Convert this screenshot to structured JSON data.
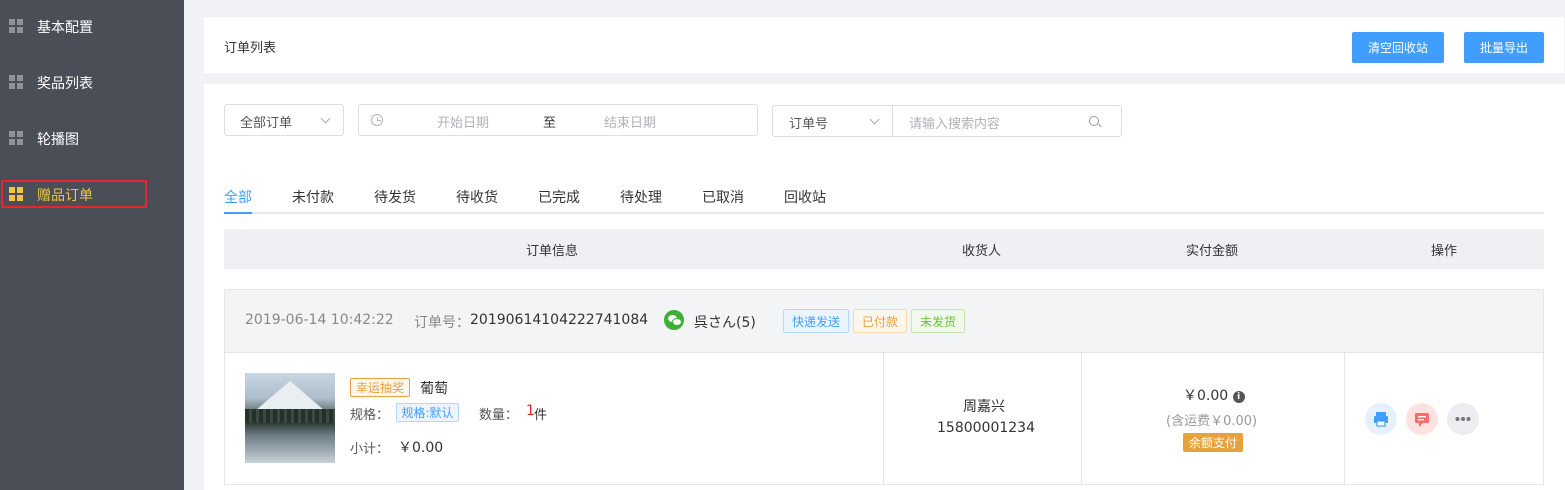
{
  "sidebar": {
    "items": [
      {
        "label": "基本配置"
      },
      {
        "label": "奖品列表"
      },
      {
        "label": "轮播图"
      },
      {
        "label": "赠品订单"
      }
    ]
  },
  "header": {
    "title": "订单列表",
    "clear_recycle_label": "清空回收站",
    "batch_export_label": "批量导出"
  },
  "filters": {
    "order_status_selected": "全部订单",
    "start_date_placeholder": "开始日期",
    "range_separator": "至",
    "end_date_placeholder": "结束日期",
    "search_type_selected": "订单号",
    "search_placeholder": "请输入搜索内容"
  },
  "tabs": [
    "全部",
    "未付款",
    "待发货",
    "待收货",
    "已完成",
    "待处理",
    "已取消",
    "回收站"
  ],
  "table": {
    "headers": [
      "订单信息",
      "收货人",
      "实付金额",
      "操作"
    ]
  },
  "order": {
    "datetime": "2019-06-14 10:42:22",
    "order_no_label": "订单号：",
    "order_no": "20190614104222741084",
    "customer": "呉さん(5)",
    "tags": [
      "快递发送",
      "已付款",
      "未发货"
    ],
    "product": {
      "badge": "幸运抽奖",
      "name": "葡萄",
      "spec_label": "规格：",
      "spec_value": "规格:默认",
      "qty_label": "数量：",
      "qty_value": "1",
      "qty_unit": "件",
      "subtotal_label": "小计：",
      "subtotal_value": "￥0.00"
    },
    "receiver_name": "周嘉兴",
    "receiver_phone": "15800001234",
    "amount": "￥0.00",
    "shipping_note": "(含运费￥0.00)",
    "payment_method": "余额支付"
  },
  "colors": {
    "sidebar_bg": "#4a4e57",
    "active_item": "#f5c542",
    "primary": "#409eff"
  }
}
